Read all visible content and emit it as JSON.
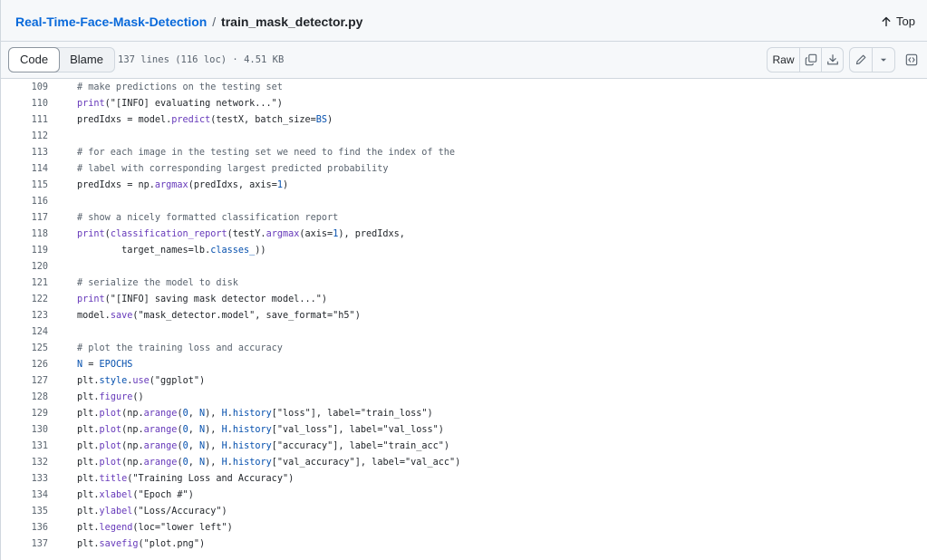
{
  "breadcrumb": {
    "repo": "Real-Time-Face-Mask-Detection",
    "separator": "/",
    "file": "train_mask_detector.py"
  },
  "top_link": {
    "label": "Top",
    "icon": "arrow-up-icon"
  },
  "toolbar": {
    "tabs": [
      {
        "label": "Code",
        "active": true
      },
      {
        "label": "Blame",
        "active": false
      }
    ],
    "file_meta": "137 lines (116 loc) · 4.51 KB",
    "raw_label": "Raw",
    "icons": [
      "copy-icon",
      "download-icon",
      "pencil-icon",
      "chevron-down-icon",
      "code-symbols-icon"
    ]
  },
  "colors": {
    "link": "#0969da",
    "comment": "#59636e",
    "function": "#6639ba",
    "keyword": "#0550ae",
    "border": "#d0d7de",
    "bar_bg": "#f6f8fa"
  },
  "code": {
    "lines": [
      {
        "n": "109",
        "tokens": [
          [
            "cm",
            "# make predictions on the testing set"
          ]
        ]
      },
      {
        "n": "110",
        "tokens": [
          [
            "fn",
            "print"
          ],
          [
            "pl",
            "(\"[INFO] evaluating network...\")"
          ]
        ]
      },
      {
        "n": "111",
        "tokens": [
          [
            "pl",
            "predIdxs = model."
          ],
          [
            "fn",
            "predict"
          ],
          [
            "pl",
            "(testX, batch_size="
          ],
          [
            "kw",
            "BS"
          ],
          [
            "pl",
            ")"
          ]
        ]
      },
      {
        "n": "112",
        "tokens": []
      },
      {
        "n": "113",
        "tokens": [
          [
            "cm",
            "# for each image in the testing set we need to find the index of the"
          ]
        ]
      },
      {
        "n": "114",
        "tokens": [
          [
            "cm",
            "# label with corresponding largest predicted probability"
          ]
        ]
      },
      {
        "n": "115",
        "tokens": [
          [
            "pl",
            "predIdxs = np."
          ],
          [
            "fn",
            "argmax"
          ],
          [
            "pl",
            "(predIdxs, axis="
          ],
          [
            "kw",
            "1"
          ],
          [
            "pl",
            ")"
          ]
        ]
      },
      {
        "n": "116",
        "tokens": []
      },
      {
        "n": "117",
        "tokens": [
          [
            "cm",
            "# show a nicely formatted classification report"
          ]
        ]
      },
      {
        "n": "118",
        "tokens": [
          [
            "fn",
            "print"
          ],
          [
            "pl",
            "("
          ],
          [
            "fn",
            "classification_report"
          ],
          [
            "pl",
            "(testY."
          ],
          [
            "fn",
            "argmax"
          ],
          [
            "pl",
            "(axis="
          ],
          [
            "kw",
            "1"
          ],
          [
            "pl",
            "), predIdxs,"
          ]
        ]
      },
      {
        "n": "119",
        "tokens": [
          [
            "pl",
            "        target_names=lb."
          ],
          [
            "kw",
            "classes_"
          ],
          [
            "pl",
            "))"
          ]
        ]
      },
      {
        "n": "120",
        "tokens": []
      },
      {
        "n": "121",
        "tokens": [
          [
            "cm",
            "# serialize the model to disk"
          ]
        ]
      },
      {
        "n": "122",
        "tokens": [
          [
            "fn",
            "print"
          ],
          [
            "pl",
            "(\"[INFO] saving mask detector model...\")"
          ]
        ]
      },
      {
        "n": "123",
        "tokens": [
          [
            "pl",
            "model."
          ],
          [
            "fn",
            "save"
          ],
          [
            "pl",
            "(\"mask_detector.model\", save_format=\"h5\")"
          ]
        ]
      },
      {
        "n": "124",
        "tokens": []
      },
      {
        "n": "125",
        "tokens": [
          [
            "cm",
            "# plot the training loss and accuracy"
          ]
        ]
      },
      {
        "n": "126",
        "tokens": [
          [
            "kw",
            "N"
          ],
          [
            "pl",
            " = "
          ],
          [
            "kw",
            "EPOCHS"
          ]
        ]
      },
      {
        "n": "127",
        "tokens": [
          [
            "pl",
            "plt."
          ],
          [
            "kw",
            "style"
          ],
          [
            "pl",
            "."
          ],
          [
            "fn",
            "use"
          ],
          [
            "pl",
            "(\"ggplot\")"
          ]
        ]
      },
      {
        "n": "128",
        "tokens": [
          [
            "pl",
            "plt."
          ],
          [
            "fn",
            "figure"
          ],
          [
            "pl",
            "()"
          ]
        ]
      },
      {
        "n": "129",
        "tokens": [
          [
            "pl",
            "plt."
          ],
          [
            "fn",
            "plot"
          ],
          [
            "pl",
            "(np."
          ],
          [
            "fn",
            "arange"
          ],
          [
            "pl",
            "("
          ],
          [
            "kw",
            "0"
          ],
          [
            "pl",
            ", "
          ],
          [
            "kw",
            "N"
          ],
          [
            "pl",
            "), "
          ],
          [
            "kw",
            "H"
          ],
          [
            "pl",
            "."
          ],
          [
            "kw",
            "history"
          ],
          [
            "pl",
            "[\"loss\"], label=\"train_loss\")"
          ]
        ]
      },
      {
        "n": "130",
        "tokens": [
          [
            "pl",
            "plt."
          ],
          [
            "fn",
            "plot"
          ],
          [
            "pl",
            "(np."
          ],
          [
            "fn",
            "arange"
          ],
          [
            "pl",
            "("
          ],
          [
            "kw",
            "0"
          ],
          [
            "pl",
            ", "
          ],
          [
            "kw",
            "N"
          ],
          [
            "pl",
            "), "
          ],
          [
            "kw",
            "H"
          ],
          [
            "pl",
            "."
          ],
          [
            "kw",
            "history"
          ],
          [
            "pl",
            "[\"val_loss\"], label=\"val_loss\")"
          ]
        ]
      },
      {
        "n": "131",
        "tokens": [
          [
            "pl",
            "plt."
          ],
          [
            "fn",
            "plot"
          ],
          [
            "pl",
            "(np."
          ],
          [
            "fn",
            "arange"
          ],
          [
            "pl",
            "("
          ],
          [
            "kw",
            "0"
          ],
          [
            "pl",
            ", "
          ],
          [
            "kw",
            "N"
          ],
          [
            "pl",
            "), "
          ],
          [
            "kw",
            "H"
          ],
          [
            "pl",
            "."
          ],
          [
            "kw",
            "history"
          ],
          [
            "pl",
            "[\"accuracy\"], label=\"train_acc\")"
          ]
        ]
      },
      {
        "n": "132",
        "tokens": [
          [
            "pl",
            "plt."
          ],
          [
            "fn",
            "plot"
          ],
          [
            "pl",
            "(np."
          ],
          [
            "fn",
            "arange"
          ],
          [
            "pl",
            "("
          ],
          [
            "kw",
            "0"
          ],
          [
            "pl",
            ", "
          ],
          [
            "kw",
            "N"
          ],
          [
            "pl",
            "), "
          ],
          [
            "kw",
            "H"
          ],
          [
            "pl",
            "."
          ],
          [
            "kw",
            "history"
          ],
          [
            "pl",
            "[\"val_accuracy\"], label=\"val_acc\")"
          ]
        ]
      },
      {
        "n": "133",
        "tokens": [
          [
            "pl",
            "plt."
          ],
          [
            "fn",
            "title"
          ],
          [
            "pl",
            "(\"Training Loss and Accuracy\")"
          ]
        ]
      },
      {
        "n": "134",
        "tokens": [
          [
            "pl",
            "plt."
          ],
          [
            "fn",
            "xlabel"
          ],
          [
            "pl",
            "(\"Epoch #\")"
          ]
        ]
      },
      {
        "n": "135",
        "tokens": [
          [
            "pl",
            "plt."
          ],
          [
            "fn",
            "ylabel"
          ],
          [
            "pl",
            "(\"Loss/Accuracy\")"
          ]
        ]
      },
      {
        "n": "136",
        "tokens": [
          [
            "pl",
            "plt."
          ],
          [
            "fn",
            "legend"
          ],
          [
            "pl",
            "(loc=\"lower left\")"
          ]
        ]
      },
      {
        "n": "137",
        "tokens": [
          [
            "pl",
            "plt."
          ],
          [
            "fn",
            "savefig"
          ],
          [
            "pl",
            "(\"plot.png\")"
          ]
        ]
      }
    ]
  }
}
